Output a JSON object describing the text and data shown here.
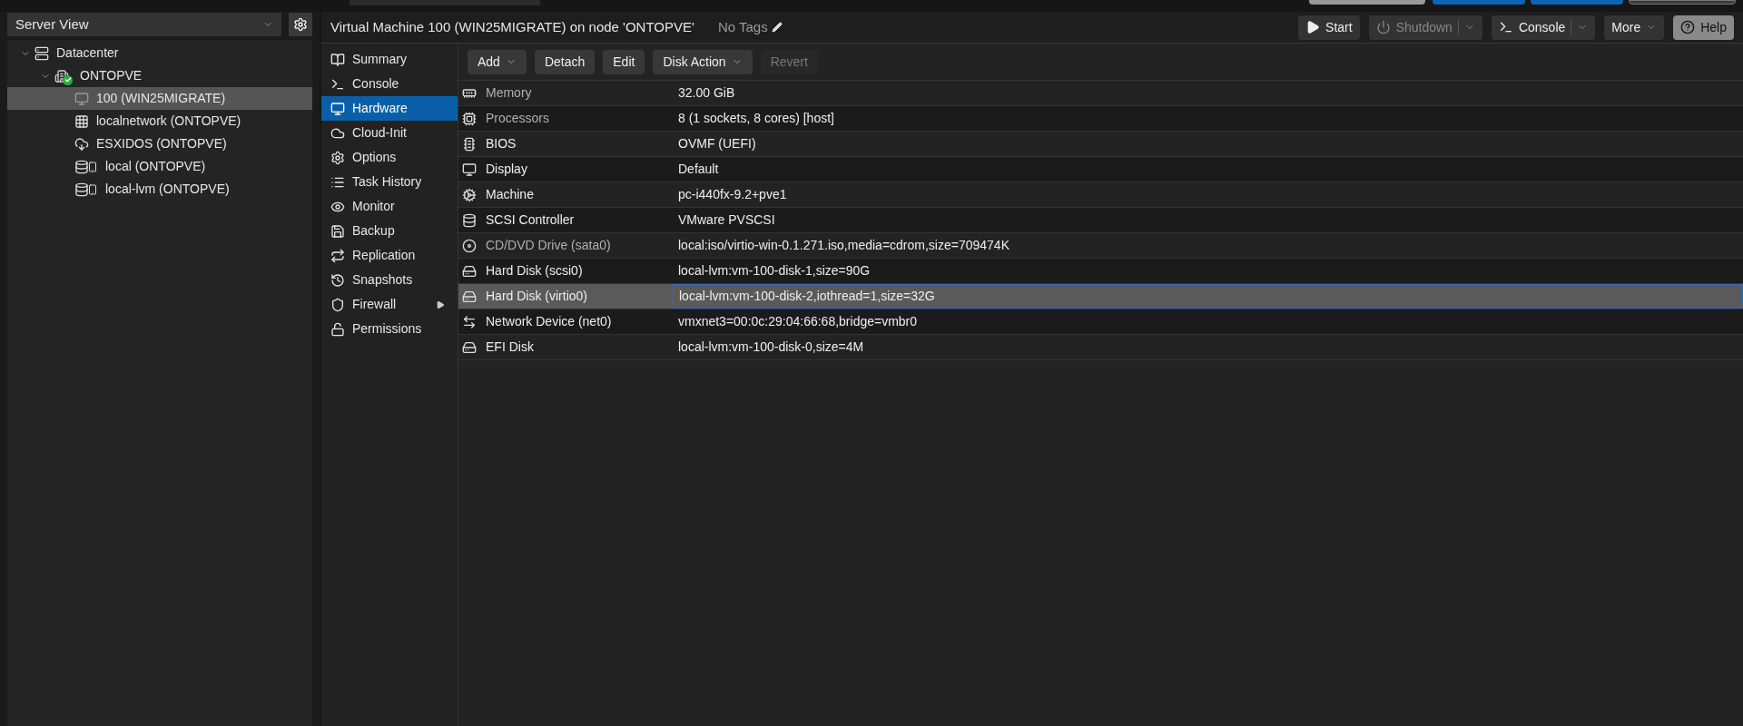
{
  "sidebar": {
    "view_select": "Server View",
    "tree": [
      {
        "label": "Datacenter",
        "kind": "datacenter",
        "expanded": true,
        "selected": false,
        "children": [
          {
            "label": "ONTOPVE",
            "kind": "node",
            "expanded": true,
            "selected": false,
            "children": [
              {
                "label": "100 (WIN25MIGRATE)",
                "kind": "vm",
                "selected": true
              },
              {
                "label": "localnetwork (ONTOPVE)",
                "kind": "network",
                "selected": false
              },
              {
                "label": "ESXIDOS (ONTOPVE)",
                "kind": "cloud",
                "selected": false
              },
              {
                "label": "local (ONTOPVE)",
                "kind": "storage",
                "selected": false
              },
              {
                "label": "local-lvm (ONTOPVE)",
                "kind": "storage",
                "selected": false
              }
            ]
          }
        ]
      }
    ]
  },
  "header": {
    "title": "Virtual Machine 100 (WIN25MIGRATE) on node 'ONTOPVE'",
    "tags": "No Tags",
    "buttons": [
      {
        "label": "Start",
        "kind": "start",
        "disabled": false
      },
      {
        "label": "Shutdown",
        "kind": "shutdown",
        "disabled": true
      },
      {
        "label": "Console",
        "kind": "console",
        "disabled": false
      },
      {
        "label": "More",
        "kind": "more",
        "disabled": false
      },
      {
        "label": "Help",
        "kind": "help",
        "disabled": false
      }
    ]
  },
  "nav": [
    {
      "label": "Summary",
      "kind": "book",
      "selected": false
    },
    {
      "label": "Console",
      "kind": "terminal",
      "selected": false
    },
    {
      "label": "Hardware",
      "kind": "monitor",
      "selected": true
    },
    {
      "label": "Cloud-Init",
      "kind": "cloud",
      "selected": false
    },
    {
      "label": "Options",
      "kind": "gear",
      "selected": false
    },
    {
      "label": "Task History",
      "kind": "list",
      "selected": false
    },
    {
      "label": "Monitor",
      "kind": "eye",
      "selected": false
    },
    {
      "label": "Backup",
      "kind": "save",
      "selected": false
    },
    {
      "label": "Replication",
      "kind": "retweet",
      "selected": false
    },
    {
      "label": "Snapshots",
      "kind": "history",
      "selected": false
    },
    {
      "label": "Firewall",
      "kind": "shield",
      "selected": false,
      "has_submenu": true
    },
    {
      "label": "Permissions",
      "kind": "unlock",
      "selected": false
    }
  ],
  "toolbar": [
    {
      "label": "Add",
      "menu": true,
      "disabled": false
    },
    {
      "label": "Detach",
      "menu": false,
      "disabled": false
    },
    {
      "label": "Edit",
      "menu": false,
      "disabled": false
    },
    {
      "label": "Disk Action",
      "menu": true,
      "disabled": false
    },
    {
      "label": "Revert",
      "menu": false,
      "disabled": true
    }
  ],
  "hardware": [
    {
      "name": "Memory",
      "value": "32.00 GiB",
      "kind": "memory",
      "dimmed": true,
      "selected": false
    },
    {
      "name": "Processors",
      "value": "8 (1 sockets, 8 cores) [host]",
      "kind": "cpu",
      "dimmed": true,
      "selected": false
    },
    {
      "name": "BIOS",
      "value": "OVMF (UEFI)",
      "kind": "chip",
      "dimmed": false,
      "selected": false
    },
    {
      "name": "Display",
      "value": "Default",
      "kind": "monitor",
      "dimmed": false,
      "selected": false
    },
    {
      "name": "Machine",
      "value": "pc-i440fx-9.2+pve1",
      "kind": "gears",
      "dimmed": false,
      "selected": false
    },
    {
      "name": "SCSI Controller",
      "value": "VMware PVSCSI",
      "kind": "database",
      "dimmed": false,
      "selected": false
    },
    {
      "name": "CD/DVD Drive (sata0)",
      "value": "local:iso/virtio-win-0.1.271.iso,media=cdrom,size=709474K",
      "kind": "disc",
      "dimmed": true,
      "selected": false
    },
    {
      "name": "Hard Disk (scsi0)",
      "value": "local-lvm:vm-100-disk-1,size=90G",
      "kind": "hdd",
      "dimmed": false,
      "selected": false
    },
    {
      "name": "Hard Disk (virtio0)",
      "value": "local-lvm:vm-100-disk-2,iothread=1,size=32G",
      "kind": "hdd",
      "dimmed": false,
      "selected": true
    },
    {
      "name": "Network Device (net0)",
      "value": "vmxnet3=00:0c:29:04:66:68,bridge=vmbr0",
      "kind": "exchange",
      "dimmed": false,
      "selected": false
    },
    {
      "name": "EFI Disk",
      "value": "local-lvm:vm-100-disk-0,size=4M",
      "kind": "hdd",
      "dimmed": false,
      "selected": false
    }
  ]
}
